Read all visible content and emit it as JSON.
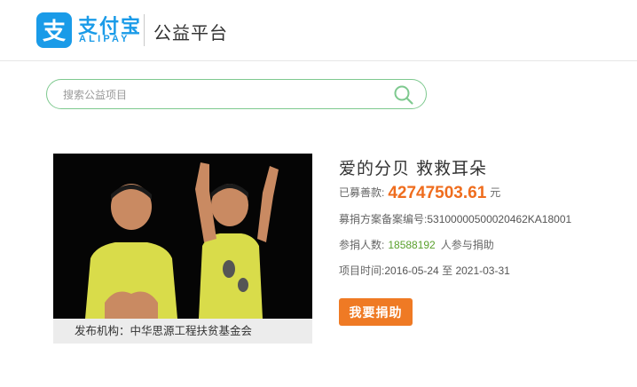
{
  "header": {
    "brand_cn": "支付宝",
    "brand_en": "ALIPAY",
    "subtitle": "公益平台",
    "logo_icon": "alipay-logo-icon",
    "brand_color": "#1a9be8"
  },
  "search": {
    "placeholder": "搜索公益项目",
    "icon": "search-icon",
    "border_color": "#7ec98f"
  },
  "project": {
    "title": "爱的分贝 救救耳朵",
    "raised_label": "已募善款:",
    "raised_amount": "42747503.61",
    "raised_unit": "元",
    "record_label": "募捐方案备案编号:",
    "record_number": "53100000500020462KA18001",
    "donors_label": "参捐人数:",
    "donors_count": "18588192",
    "donors_suffix": "人参与捐助",
    "period_label": "项目时间:",
    "start_date": "2016-05-24",
    "date_sep": "至",
    "end_date": "2021-03-31",
    "donate_button": "我要捐助",
    "publisher": "发布机构：中华思源工程扶贫基金会",
    "amount_color": "#ef6d1e",
    "count_color": "#5aa02c",
    "button_color": "#ef7a24"
  }
}
